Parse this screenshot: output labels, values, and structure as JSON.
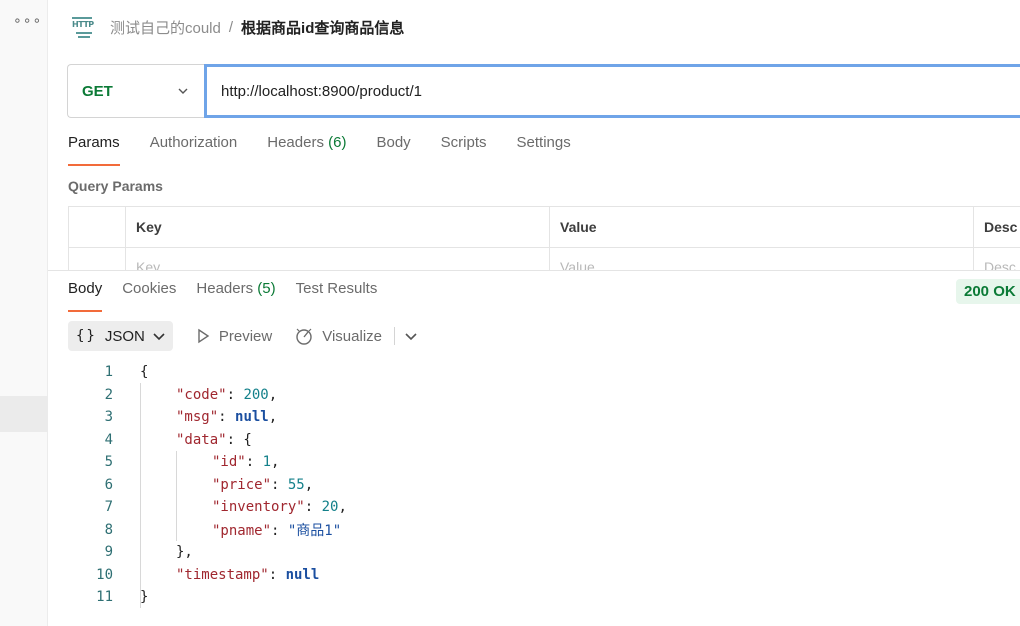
{
  "header": {
    "icon_label": "HTTP",
    "collection_name": "测试自己的could",
    "separator": "/",
    "request_name": "根据商品id查询商品信息"
  },
  "request": {
    "method": "GET",
    "url": "http://localhost:8900/product/1"
  },
  "request_tabs": [
    {
      "label": "Params",
      "count": ""
    },
    {
      "label": "Authorization",
      "count": ""
    },
    {
      "label": "Headers",
      "count": "(6)"
    },
    {
      "label": "Body",
      "count": ""
    },
    {
      "label": "Scripts",
      "count": ""
    },
    {
      "label": "Settings",
      "count": ""
    }
  ],
  "query_params": {
    "title": "Query Params",
    "columns": [
      "Key",
      "Value",
      "Desc"
    ],
    "placeholder_row": [
      "Key",
      "Value",
      "Desc"
    ]
  },
  "response_tabs": [
    {
      "label": "Body",
      "count": ""
    },
    {
      "label": "Cookies",
      "count": ""
    },
    {
      "label": "Headers",
      "count": "(5)"
    },
    {
      "label": "Test Results",
      "count": ""
    }
  ],
  "status": "200 OK",
  "toolbar": {
    "format": "JSON",
    "preview": "Preview",
    "visualize": "Visualize"
  },
  "response_body": {
    "line_numbers": [
      "1",
      "2",
      "3",
      "4",
      "5",
      "6",
      "7",
      "8",
      "9",
      "10",
      "11"
    ],
    "lines": [
      "{",
      "\"code\": 200,",
      "\"msg\": null,",
      "\"data\": {",
      "\"id\": 1,",
      "\"price\": 55,",
      "\"inventory\": 20,",
      "\"pname\": \"商品1\"",
      "},",
      "\"timestamp\": null",
      "}"
    ]
  }
}
